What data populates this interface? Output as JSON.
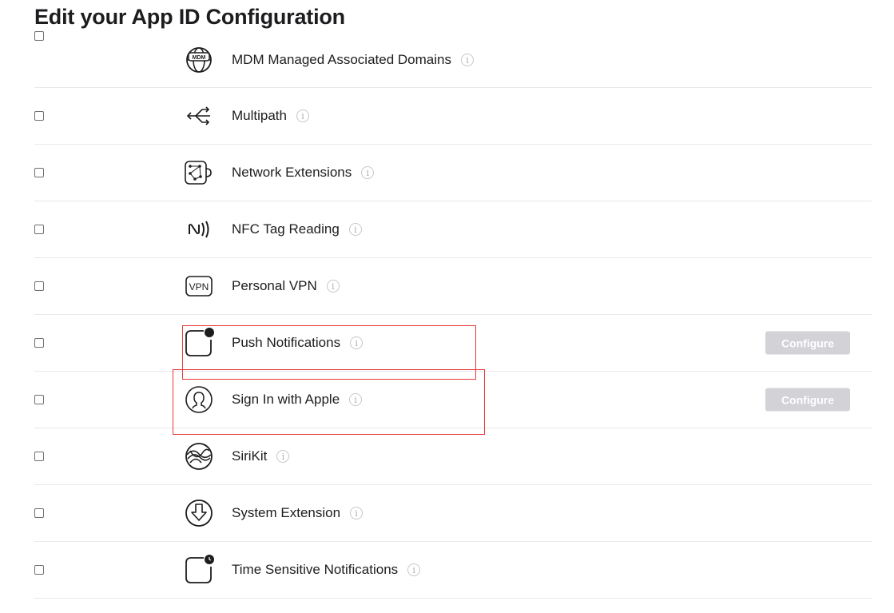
{
  "page": {
    "title": "Edit your App ID Configuration"
  },
  "capabilities": [
    {
      "label": "MDM Managed Associated Domains",
      "icon": "globe-mdm-icon",
      "checked": false
    },
    {
      "label": "Multipath",
      "icon": "multipath-arrows-icon",
      "checked": false
    },
    {
      "label": "Network Extensions",
      "icon": "network-extensions-icon",
      "checked": false
    },
    {
      "label": "NFC Tag Reading",
      "icon": "nfc-icon",
      "checked": false
    },
    {
      "label": "Personal VPN",
      "icon": "vpn-icon",
      "checked": false
    },
    {
      "label": "Push Notifications",
      "icon": "push-notification-icon",
      "checked": false,
      "configure_label": "Configure"
    },
    {
      "label": "Sign In with Apple",
      "icon": "person-circle-icon",
      "checked": false,
      "configure_label": "Configure"
    },
    {
      "label": "SiriKit",
      "icon": "siri-icon",
      "checked": false
    },
    {
      "label": "System Extension",
      "icon": "system-extension-icon",
      "checked": false
    },
    {
      "label": "Time Sensitive Notifications",
      "icon": "time-sensitive-notification-icon",
      "checked": false
    }
  ],
  "info_glyph": "i",
  "colors": {
    "highlight": "#e8393a",
    "button_disabled": "#d2d2d7",
    "divider": "#e8e8ed"
  }
}
